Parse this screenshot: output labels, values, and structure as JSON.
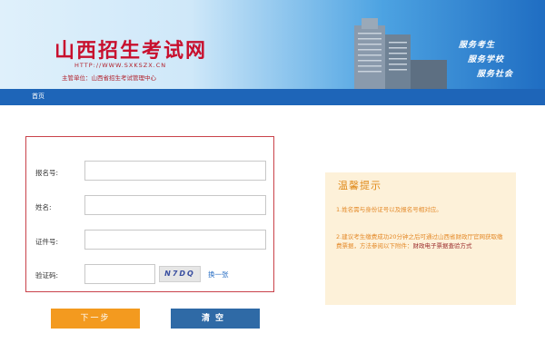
{
  "header": {
    "title": "山西招生考试网",
    "url": "HTTP://WWW.SXKSZX.CN",
    "sponsor": "主管单位：山西省招生考试管理中心",
    "slogans": [
      "服务考生",
      "服务学校",
      "服务社会"
    ]
  },
  "nav": {
    "home": "首页"
  },
  "form": {
    "reg_label": "报名号:",
    "name_label": "姓名:",
    "id_label": "证件号:",
    "captcha_label": "验证码:",
    "captcha_code": "N7DQ",
    "refresh_link": "换一张",
    "reg_value": "",
    "name_value": "",
    "id_value": "",
    "captcha_value": ""
  },
  "tips": {
    "title": "温馨提示",
    "item1": "1.姓名需与身份证号以及报名号相对应。",
    "item2": "2.建议考生缴费成功20分钟之后可通过山西省财政厅官网获取缴费票据，方法参阅以下附件：",
    "item2_link": "财政电子票据查验方式"
  },
  "buttons": {
    "next": "下一步",
    "clear": "清空"
  },
  "colors": {
    "brand_blue": "#1e65b8",
    "title_red": "#c8102e",
    "form_border": "#c9424a",
    "next_orange": "#f39a1f",
    "clear_blue": "#2f6aa6",
    "tips_bg": "#fdf1d9"
  }
}
